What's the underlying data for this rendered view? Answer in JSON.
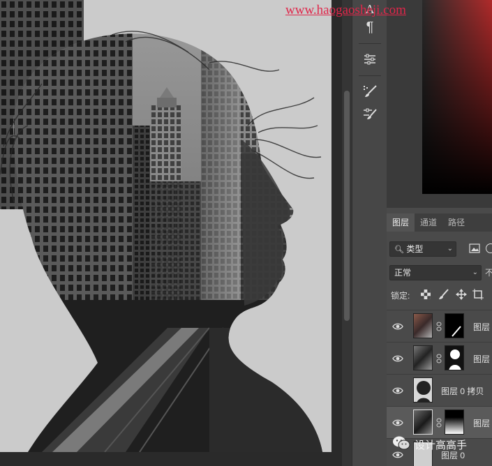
{
  "watermark": {
    "url": "www.haogaosheji.com"
  },
  "tools": [
    {
      "icon": "type-tool-icon",
      "glyph": "A"
    },
    {
      "icon": "paragraph-icon",
      "glyph": "¶"
    },
    {
      "icon": "adjustments-sliders-icon",
      "glyph": ""
    },
    {
      "icon": "brush-settings-icon",
      "glyph": ""
    },
    {
      "icon": "brush-presets-icon",
      "glyph": ""
    }
  ],
  "layers_panel": {
    "tabs": [
      "图层",
      "通道",
      "路径"
    ],
    "active_tab": "图层",
    "filter_label": "类型",
    "blend_mode": "正常",
    "opacity_label_fragment": "不",
    "lock_label": "锁定:",
    "layers": [
      {
        "name": "图层",
        "visible": true,
        "has_mask": true,
        "selected": false
      },
      {
        "name": "图层",
        "visible": true,
        "has_mask": true,
        "selected": false
      },
      {
        "name": "图层 0 拷贝",
        "visible": true,
        "has_mask": false,
        "selected": false
      },
      {
        "name": "图层",
        "visible": true,
        "has_mask": true,
        "selected": true
      },
      {
        "name": "图层 0",
        "visible": true,
        "has_mask": false,
        "selected": false
      }
    ]
  },
  "badge": {
    "text": "设计高高手"
  },
  "colors": {
    "watermark": "#e0264a",
    "panel_bg": "#4a4a4a",
    "tool_bg": "#474747",
    "selected_row": "#5a5a5a"
  }
}
